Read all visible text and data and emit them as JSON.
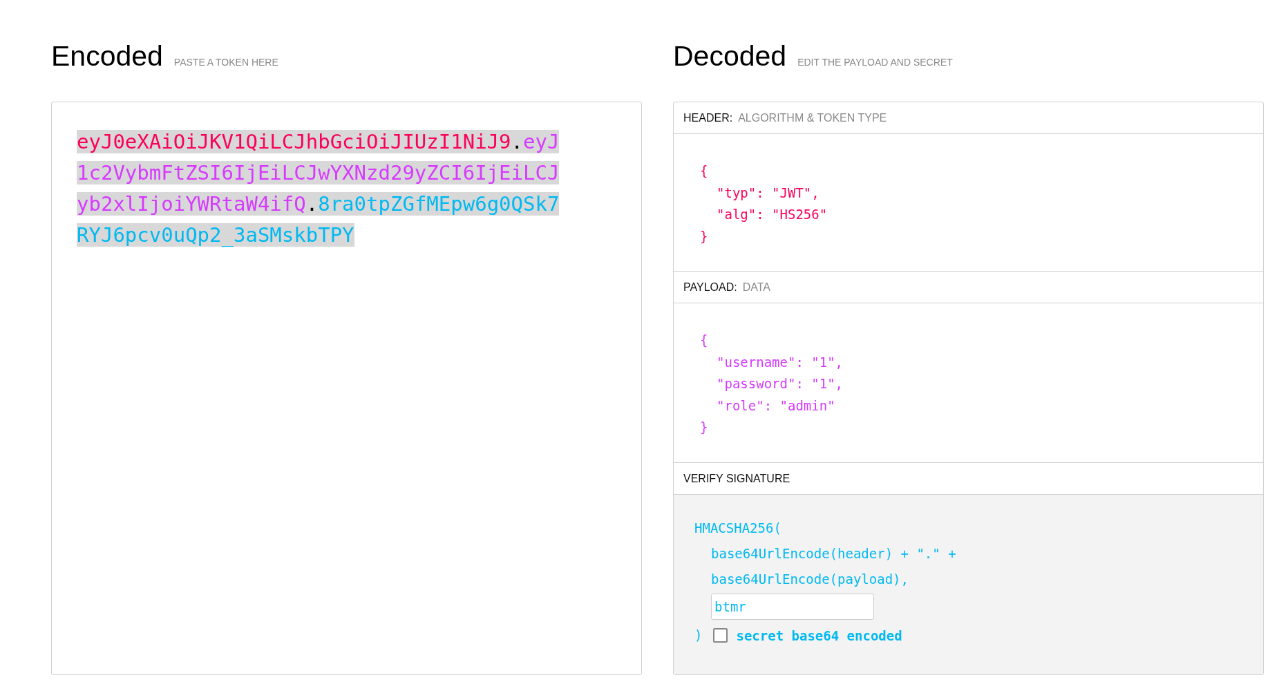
{
  "encoded": {
    "title": "Encoded",
    "subtitle": "PASTE A TOKEN HERE",
    "token": [
      {
        "kind": "header",
        "text": "eyJ0eXAiOiJKV1QiLCJhbGciOiJIUzI1NiJ9"
      },
      {
        "kind": "dot",
        "text": "."
      },
      {
        "kind": "payload",
        "text": "eyJ1c2VybmFtZSI6IjEiLCJwYXNzd29yZCI6IjEiLCJyb2xlIjoiYWRtaW4ifQ"
      },
      {
        "kind": "dot",
        "text": "."
      },
      {
        "kind": "signature",
        "text": "8ra0tpZGfMEpw6g0QSk7RYJ6pcv0uQp2_3aSMskbTPY"
      }
    ]
  },
  "decoded": {
    "title": "Decoded",
    "subtitle": "EDIT THE PAYLOAD AND SECRET",
    "sections": [
      {
        "kind": "header",
        "label": "HEADER:",
        "sublabel": "ALGORITHM & TOKEN TYPE",
        "open": "{",
        "entries": [
          "\"typ\": \"JWT\",",
          "\"alg\": \"HS256\""
        ],
        "close": "}"
      },
      {
        "kind": "payload",
        "label": "PAYLOAD:",
        "sublabel": "DATA",
        "open": "{",
        "entries": [
          "\"username\": \"1\",",
          "\"password\": \"1\",",
          "\"role\": \"admin\""
        ],
        "close": "}"
      }
    ],
    "verify": {
      "label": "VERIFY SIGNATURE",
      "open": "HMACSHA256(",
      "args": [
        "base64UrlEncode(header) + \".\" +",
        "base64UrlEncode(payload),"
      ],
      "secret": "btmr",
      "close": ")",
      "base64_checkbox": {
        "label": "secret base64 encoded",
        "checked": false
      }
    }
  }
}
